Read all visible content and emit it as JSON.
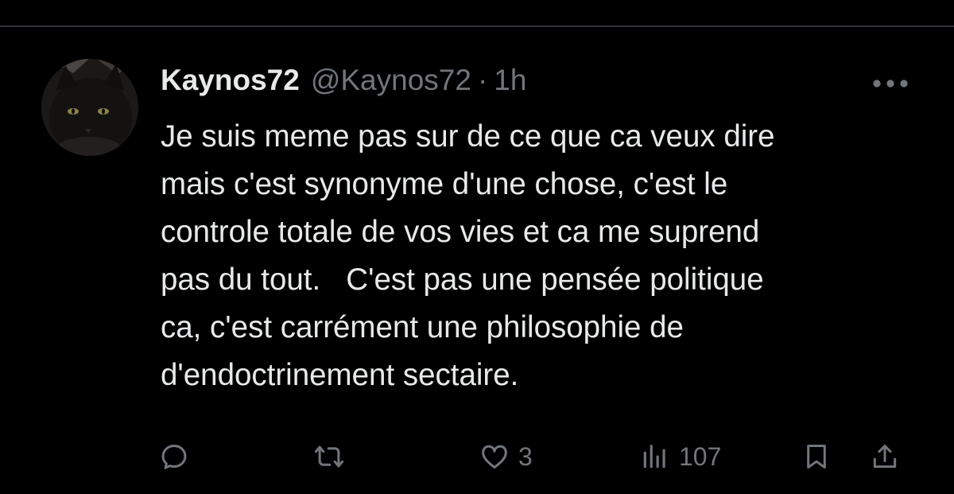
{
  "tweet": {
    "display_name": "Kaynos72",
    "handle": "@Kaynos72",
    "separator": "·",
    "time": "1h",
    "text": "Je suis meme pas sur de ce que ca veux dire\nmais c'est synonyme d'une chose, c'est le\ncontrole totale de vos vies et ca me suprend\npas du tout.   C'est pas une pensée politique\nca, c'est carrément une philosophie de\nd'endoctrinement sectaire.",
    "avatar_icon": "black-cat-avatar"
  },
  "actions": {
    "reply_icon": "reply-icon",
    "repost_icon": "repost-icon",
    "like_icon": "heart-icon",
    "like_count": "3",
    "views_icon": "views-chart-icon",
    "views_count": "107",
    "bookmark_icon": "bookmark-icon",
    "share_icon": "share-icon",
    "more_icon": "more-horizontal-icon"
  },
  "colors": {
    "background": "#000000",
    "text_primary": "#e7e9ea",
    "text_secondary": "#71767b",
    "divider": "#2f3336"
  }
}
